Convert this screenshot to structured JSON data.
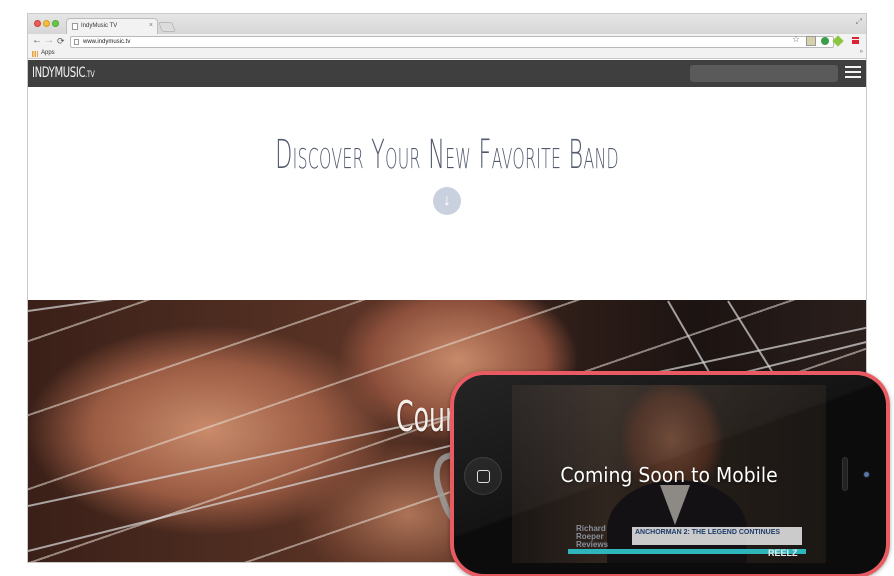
{
  "browser": {
    "tab_title": "IndyMusic TV",
    "tab_close": "×",
    "url": "www.indymusic.tv",
    "bookmarks_apps": "Apps"
  },
  "site": {
    "logo_main": "INDYMUSIC",
    "logo_tld": ".TV",
    "search_placeholder": "",
    "hero_title": "Discover Your New Favorite Band",
    "hero_arrow": "↓",
    "hero_overlay_text": "Coun"
  },
  "phone": {
    "screen_text": "Coming Soon to Mobile",
    "show_label": "Richard Roeper Reviews",
    "show_title": "ANCHORMAN 2: THE LEGEND CONTINUES",
    "channel_logo": "REELZ"
  },
  "icons": {
    "back": "←",
    "forward": "→",
    "reload": "C",
    "star": "☆"
  }
}
